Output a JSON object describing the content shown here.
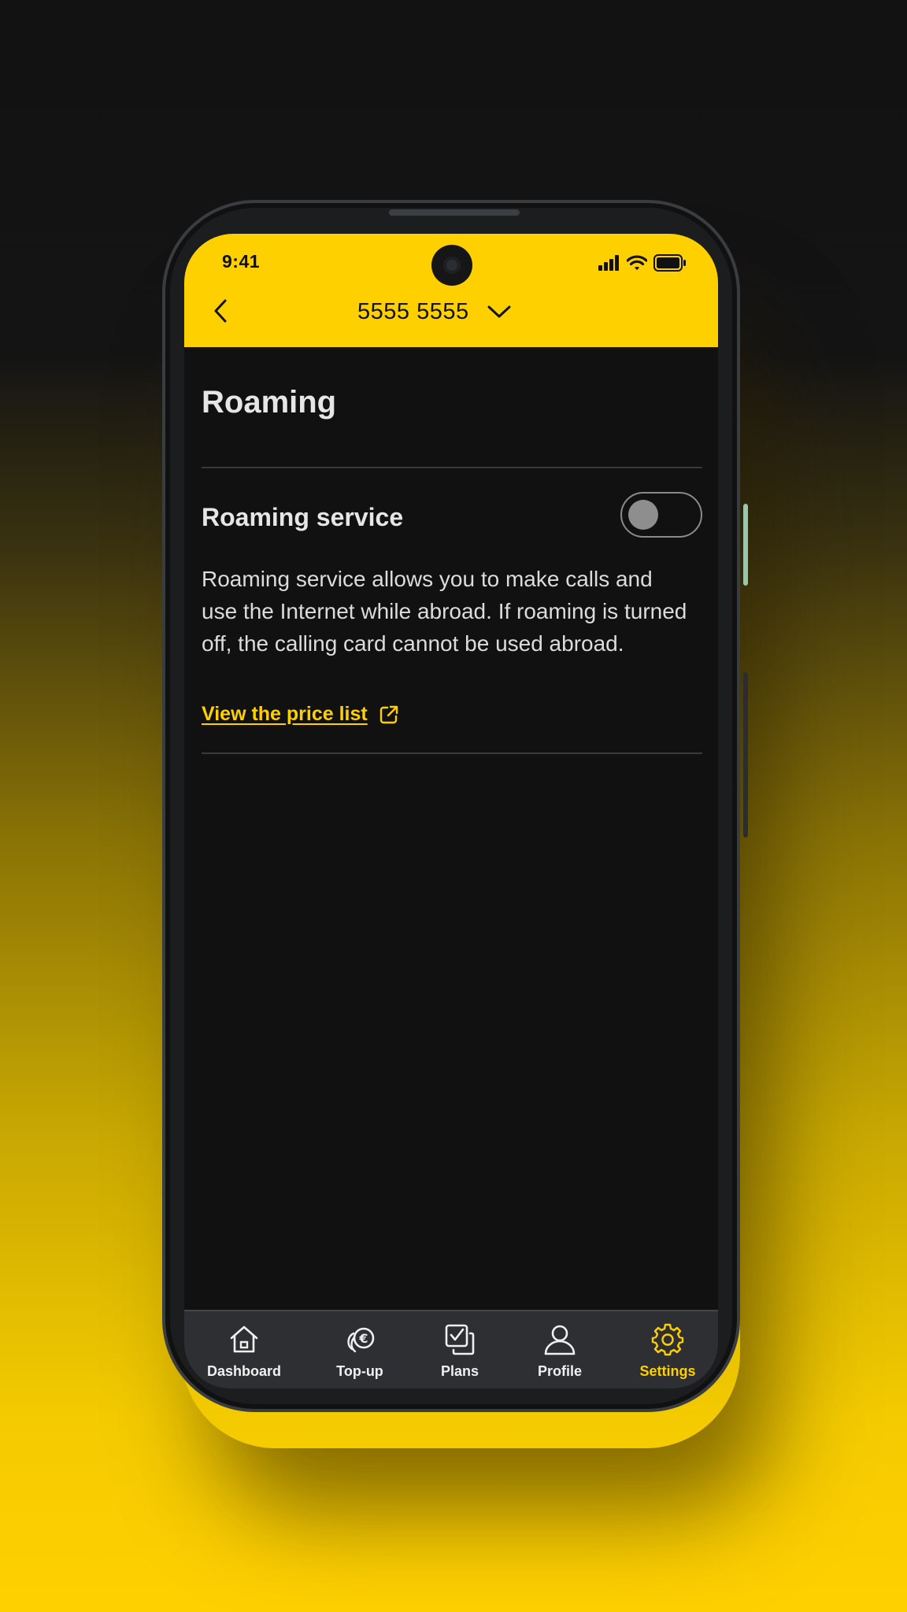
{
  "status_bar": {
    "time": "9:41"
  },
  "header": {
    "phone_number": "5555 5555"
  },
  "page": {
    "title": "Roaming"
  },
  "roaming": {
    "section_title": "Roaming service",
    "toggle_on": false,
    "description": "Roaming service allows you to make calls and use the Internet while abroad. If roaming is turned off, the calling card cannot be used abroad.",
    "price_link": "View the price list"
  },
  "tabs": [
    {
      "label": "Dashboard",
      "icon": "home-icon",
      "active": false
    },
    {
      "label": "Top-up",
      "icon": "euro-coins-icon",
      "active": false
    },
    {
      "label": "Plans",
      "icon": "plans-checkbox-icon",
      "active": false
    },
    {
      "label": "Profile",
      "icon": "person-icon",
      "active": false
    },
    {
      "label": "Settings",
      "icon": "gear-icon",
      "active": true
    }
  ],
  "colors": {
    "accent": "#ffd000",
    "background": "#111111",
    "tabbar": "#2e2f33"
  }
}
